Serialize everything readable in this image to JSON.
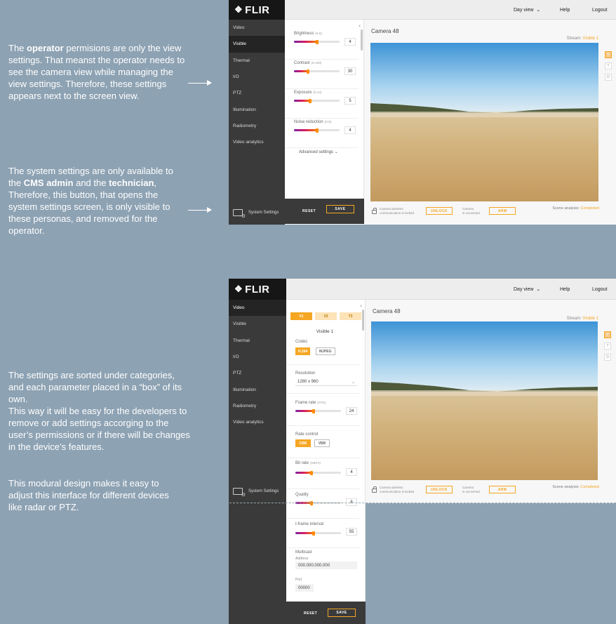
{
  "annotations": {
    "operator_note": {
      "p1": "The ",
      "b1": "operator",
      "p2": " permisions are only the view settings. That meanst the operator needs to see the camera view while managing the view settings. Therefore, these settings appears next to the screen view."
    },
    "system_note": {
      "p1": "The system settings are only available to the ",
      "b1": "CMS admin",
      "p2": " and the ",
      "b2": "technician",
      "p3": ", Therefore, this button, that opens the system settings screen, is only visible to these personas, and removed for the operator."
    },
    "categories_note": "The settings are sorted under categories, and each parameter placed in a “box” of its own.\nThis way it will be easy for the developers to remove or add settings accorging to the user’s permissions or if there will be changes in the device’s features.",
    "modular_note": "This modural design makes it easy to adjust this interface for different devices like radar or PTZ."
  },
  "app": {
    "logo": "FLIR",
    "nav": {
      "view": "Day view",
      "help": "Help",
      "logout": "Logout"
    },
    "sidebar": [
      "Video",
      "Visible",
      "Thermal",
      "I/O",
      "PTZ",
      "Illumination",
      "Radiometry",
      "Video analytics"
    ],
    "system_settings": "System Settings",
    "reset": "RESET",
    "save": "SAVE",
    "camera_title": "Camera 48",
    "stream_label": "Stream:",
    "stream_value": "Visible 1",
    "lock_text_1": "Camera wireless",
    "lock_text_2": "communication is locked",
    "unlock": "UNLOCK",
    "arm_text_1": "Camera",
    "arm_text_2": "is not armed",
    "arm": "ARM",
    "scene_label": "Scene analysis:",
    "scene_value": "Completed",
    "side_buttons": [
      "V",
      "T",
      "D"
    ]
  },
  "screen1": {
    "active_item": "Visible",
    "params": [
      {
        "label": "Brightness",
        "range": "(0-8)",
        "value": "4",
        "fraction": 0.5
      },
      {
        "label": "Contrast",
        "range": "(0-100)",
        "value": "30",
        "fraction": 0.3
      },
      {
        "label": "Exposure",
        "range": "(0-14)",
        "value": "5",
        "fraction": 0.36
      },
      {
        "label": "Noise reduction",
        "range": "(0-8)",
        "value": "4",
        "fraction": 0.5
      }
    ],
    "advanced": "Advanced settings"
  },
  "screen2": {
    "active_item": "Video",
    "tabs": [
      "V1",
      "V2",
      "T3"
    ],
    "stream_title": "Visible 1",
    "codec_label": "Codec",
    "codec_options": [
      "H.264",
      "MJPEG"
    ],
    "resolution_label": "Resolution",
    "resolution_value": "1280 x 960",
    "framerate": {
      "label": "Frame rate",
      "range": "(FPS)",
      "value": "24",
      "fraction": 0.4
    },
    "ratecontrol_label": "Rate control",
    "ratecontrol_options": [
      "CBR",
      "VBR"
    ],
    "bitrate": {
      "label": "Bit rate",
      "range": "(KBPS)",
      "value": "4",
      "fraction": 0.35
    },
    "quality": {
      "label": "Quality",
      "range": "",
      "value": "8",
      "fraction": 0.35
    },
    "iframe": {
      "label": "I-frame interval",
      "range": "",
      "value": "55",
      "fraction": 0.4
    },
    "multicast_label": "Multicast",
    "address_label": "Address",
    "address_value": "000.000.000.000",
    "port_label": "Port",
    "port_value": "00000"
  }
}
